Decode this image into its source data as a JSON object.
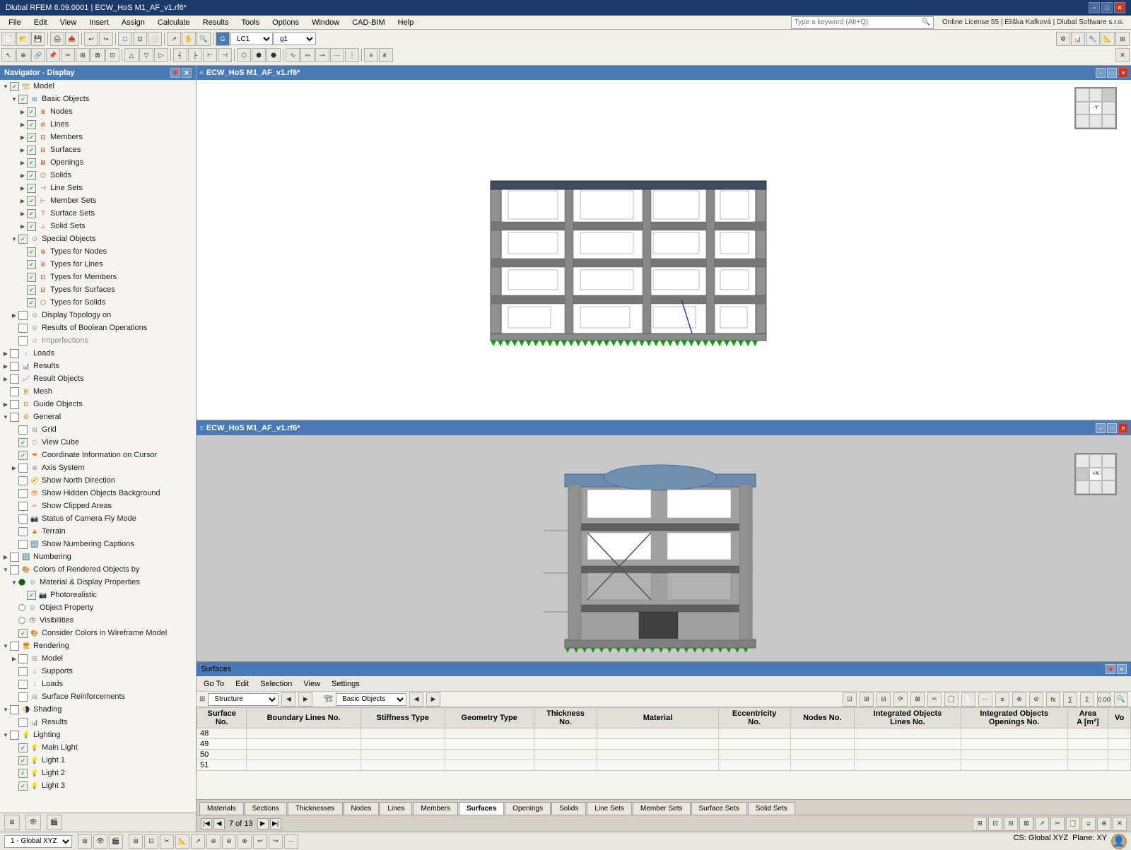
{
  "app": {
    "title": "Dlubal RFEM 6.09.0001 | ECW_HoS M1_AF_v1.rf6*",
    "min_label": "−",
    "max_label": "□",
    "close_label": "✕"
  },
  "menu": {
    "items": [
      "File",
      "Edit",
      "View",
      "Insert",
      "Assign",
      "Calculate",
      "Results",
      "Tools",
      "Options",
      "Window",
      "CAD-BIM",
      "Help"
    ]
  },
  "search": {
    "placeholder": "Type a keyword (Alt+Q)"
  },
  "license": "Online License 55 | Eliška Kafková | Dlubal Software s.r.o.",
  "navigator": {
    "title": "Navigator - Display",
    "tree": [
      {
        "id": "model",
        "label": "Model",
        "level": 0,
        "checked": true,
        "expanded": true,
        "has_arrow": true
      },
      {
        "id": "basic-objects",
        "label": "Basic Objects",
        "level": 1,
        "checked": true,
        "expanded": true,
        "has_arrow": true
      },
      {
        "id": "nodes",
        "label": "Nodes",
        "level": 2,
        "checked": true,
        "has_arrow": true
      },
      {
        "id": "lines",
        "label": "Lines",
        "level": 2,
        "checked": true,
        "has_arrow": true
      },
      {
        "id": "members",
        "label": "Members",
        "level": 2,
        "checked": true,
        "has_arrow": true
      },
      {
        "id": "surfaces",
        "label": "Surfaces",
        "level": 2,
        "checked": true,
        "has_arrow": true
      },
      {
        "id": "openings",
        "label": "Openings",
        "level": 2,
        "checked": true,
        "has_arrow": true
      },
      {
        "id": "solids",
        "label": "Solids",
        "level": 2,
        "checked": true,
        "has_arrow": true
      },
      {
        "id": "line-sets",
        "label": "Line Sets",
        "level": 2,
        "checked": true,
        "has_arrow": true
      },
      {
        "id": "member-sets",
        "label": "Member Sets",
        "level": 2,
        "checked": true,
        "has_arrow": true
      },
      {
        "id": "surface-sets",
        "label": "Surface Sets",
        "level": 2,
        "checked": true,
        "has_arrow": true
      },
      {
        "id": "solid-sets",
        "label": "Solid Sets",
        "level": 2,
        "checked": true,
        "has_arrow": true
      },
      {
        "id": "special-objects",
        "label": "Special Objects",
        "level": 1,
        "checked": true,
        "expanded": true,
        "has_arrow": true
      },
      {
        "id": "types-nodes",
        "label": "Types for Nodes",
        "level": 2,
        "checked": true,
        "has_arrow": false
      },
      {
        "id": "types-lines",
        "label": "Types for Lines",
        "level": 2,
        "checked": true,
        "has_arrow": false
      },
      {
        "id": "types-members",
        "label": "Types for Members",
        "level": 2,
        "checked": true,
        "has_arrow": false
      },
      {
        "id": "types-surfaces",
        "label": "Types for Surfaces",
        "level": 2,
        "checked": true,
        "has_arrow": false
      },
      {
        "id": "types-solids",
        "label": "Types for Solids",
        "level": 2,
        "checked": true,
        "has_arrow": false
      },
      {
        "id": "display-topology",
        "label": "Display Topology on",
        "level": 1,
        "checked": false,
        "expanded": false,
        "has_arrow": true
      },
      {
        "id": "results-bool",
        "label": "Results of Boolean Operations",
        "level": 1,
        "checked": false,
        "has_arrow": false
      },
      {
        "id": "imperfections",
        "label": "Imperfections",
        "level": 1,
        "checked": false,
        "has_arrow": false,
        "gray": true
      },
      {
        "id": "loads",
        "label": "Loads",
        "level": 0,
        "checked": false,
        "expanded": false,
        "has_arrow": true
      },
      {
        "id": "results",
        "label": "Results",
        "level": 0,
        "checked": false,
        "expanded": false,
        "has_arrow": true
      },
      {
        "id": "result-objects",
        "label": "Result Objects",
        "level": 0,
        "checked": false,
        "expanded": false,
        "has_arrow": true
      },
      {
        "id": "mesh",
        "label": "Mesh",
        "level": 0,
        "checked": false,
        "expanded": false,
        "has_arrow": false
      },
      {
        "id": "guide-objects",
        "label": "Guide Objects",
        "level": 0,
        "checked": false,
        "expanded": false,
        "has_arrow": true
      },
      {
        "id": "general",
        "label": "General",
        "level": 0,
        "checked": false,
        "expanded": true,
        "has_arrow": true
      },
      {
        "id": "grid",
        "label": "Grid",
        "level": 1,
        "checked": false,
        "has_arrow": false
      },
      {
        "id": "view-cube",
        "label": "View Cube",
        "level": 1,
        "checked": true,
        "has_arrow": false
      },
      {
        "id": "coord-cursor",
        "label": "Coordinate Information on Cursor",
        "level": 1,
        "checked": true,
        "has_arrow": false
      },
      {
        "id": "axis-system",
        "label": "Axis System",
        "level": 1,
        "checked": false,
        "expanded": false,
        "has_arrow": true
      },
      {
        "id": "show-north",
        "label": "Show North Direction",
        "level": 1,
        "checked": false,
        "has_arrow": false
      },
      {
        "id": "show-hidden",
        "label": "Show Hidden Objects in Background",
        "level": 1,
        "checked": false,
        "has_arrow": false
      },
      {
        "id": "show-clipped",
        "label": "Show Clipped Areas",
        "level": 1,
        "checked": false,
        "has_arrow": false
      },
      {
        "id": "camera-fly",
        "label": "Status of Camera Fly Mode",
        "level": 1,
        "checked": false,
        "has_arrow": false
      },
      {
        "id": "terrain",
        "label": "Terrain",
        "level": 1,
        "checked": false,
        "has_arrow": false
      },
      {
        "id": "show-numbering",
        "label": "Show Numbering Captions",
        "level": 1,
        "checked": false,
        "has_arrow": false
      },
      {
        "id": "numbering",
        "label": "Numbering",
        "level": 0,
        "checked": false,
        "expanded": false,
        "has_arrow": true
      },
      {
        "id": "colors-rendered",
        "label": "Colors of Rendered Objects by",
        "level": 0,
        "checked": false,
        "expanded": true,
        "has_arrow": true
      },
      {
        "id": "material-display",
        "label": "Material & Display Properties",
        "level": 1,
        "checked": true,
        "radio": true,
        "expanded": true,
        "has_arrow": false
      },
      {
        "id": "photorealistic",
        "label": "Photorealistic",
        "level": 2,
        "checked": true,
        "has_arrow": false
      },
      {
        "id": "object-property",
        "label": "Object Property",
        "level": 1,
        "checked": false,
        "radio": true,
        "has_arrow": false
      },
      {
        "id": "visibilities",
        "label": "Visibilities",
        "level": 1,
        "checked": false,
        "radio": true,
        "has_arrow": false
      },
      {
        "id": "consider-colors",
        "label": "Consider Colors in Wireframe Model",
        "level": 1,
        "checked": true,
        "has_arrow": false
      },
      {
        "id": "rendering",
        "label": "Rendering",
        "level": 0,
        "checked": false,
        "expanded": true,
        "has_arrow": true
      },
      {
        "id": "ren-model",
        "label": "Model",
        "level": 1,
        "checked": false,
        "expanded": false,
        "has_arrow": true
      },
      {
        "id": "ren-supports",
        "label": "Supports",
        "level": 1,
        "checked": false,
        "has_arrow": false
      },
      {
        "id": "ren-loads",
        "label": "Loads",
        "level": 1,
        "checked": false,
        "has_arrow": false
      },
      {
        "id": "surface-reinforcements",
        "label": "Surface Reinforcements",
        "level": 1,
        "checked": false,
        "has_arrow": false
      },
      {
        "id": "shading",
        "label": "Shading",
        "level": 0,
        "checked": false,
        "expanded": true,
        "has_arrow": true
      },
      {
        "id": "sha-results",
        "label": "Results",
        "level": 1,
        "checked": false,
        "has_arrow": false
      },
      {
        "id": "lighting",
        "label": "Lighting",
        "level": 0,
        "checked": false,
        "expanded": true,
        "has_arrow": true
      },
      {
        "id": "main-light",
        "label": "Main Light",
        "level": 1,
        "checked": true,
        "has_arrow": false
      },
      {
        "id": "light1",
        "label": "Light 1",
        "level": 1,
        "checked": true,
        "has_arrow": false
      },
      {
        "id": "light2",
        "label": "Light 2",
        "level": 1,
        "checked": true,
        "has_arrow": false
      },
      {
        "id": "light3",
        "label": "Light 3",
        "level": 1,
        "checked": true,
        "has_arrow": false
      }
    ]
  },
  "viewports": [
    {
      "id": "vp-top",
      "title": "ECW_HoS M1_AF_v1.rf6*",
      "cube_label": "-Y"
    },
    {
      "id": "vp-bottom",
      "title": "ECW_HoS M1_AF_v1.rf6*",
      "cube_label": "+X"
    }
  ],
  "surfaces_panel": {
    "title": "Surfaces",
    "menu_items": [
      "Go To",
      "Edit",
      "Selection",
      "View",
      "Settings"
    ],
    "filter_structure": "Structure",
    "filter_basic": "Basic Objects",
    "columns": [
      "Surface No.",
      "Boundary Lines No.",
      "Stiffness Type",
      "Geometry Type",
      "Thickness No.",
      "Material",
      "Eccentricity No.",
      "Nodes No.",
      "Integrated Objects Lines No.",
      "Integrated Objects Openings No.",
      "Area A [m²]",
      "Vo"
    ],
    "rows": [
      {
        "no": "48",
        "boundary": "",
        "stiffness": "",
        "geometry": "",
        "thickness": "",
        "material": "",
        "eccentricity": "",
        "nodes": "",
        "lines": "",
        "openings": "",
        "area": "",
        "vo": ""
      },
      {
        "no": "49",
        "boundary": "",
        "stiffness": "",
        "geometry": "",
        "thickness": "",
        "material": "",
        "eccentricity": "",
        "nodes": "",
        "lines": "",
        "openings": "",
        "area": "",
        "vo": ""
      },
      {
        "no": "50",
        "boundary": "",
        "stiffness": "",
        "geometry": "",
        "thickness": "",
        "material": "",
        "eccentricity": "",
        "nodes": "",
        "lines": "",
        "openings": "",
        "area": "",
        "vo": ""
      },
      {
        "no": "51",
        "boundary": "",
        "stiffness": "",
        "geometry": "",
        "thickness": "",
        "material": "",
        "eccentricity": "",
        "nodes": "",
        "lines": "",
        "openings": "",
        "area": "",
        "vo": ""
      }
    ]
  },
  "bottom_tabs": [
    "Materials",
    "Sections",
    "Thicknesses",
    "Nodes",
    "Lines",
    "Members",
    "Surfaces",
    "Openings",
    "Solids",
    "Line Sets",
    "Member Sets",
    "Surface Sets",
    "Solid Sets"
  ],
  "active_tab": "Surfaces",
  "pager": {
    "current": "7 of 13"
  },
  "status_bar": {
    "coord_system": "1 - Global XYZ",
    "cs_label": "CS: Global XYZ",
    "plane_label": "Plane: XY"
  },
  "bottom_icons": [
    "⊞",
    "👁",
    "🎬"
  ],
  "lc_label": "LC1",
  "g1_label": "g1"
}
